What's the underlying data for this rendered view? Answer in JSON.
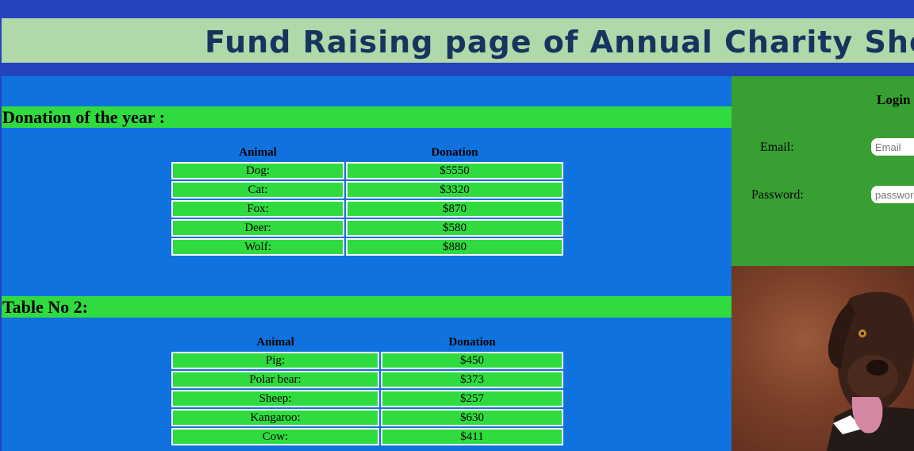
{
  "header": {
    "title": "Fund Raising page of Annual Charity Show"
  },
  "section1": {
    "title": "Donation of the year :",
    "headers": [
      "Animal",
      "Donation"
    ],
    "rows": [
      [
        "Dog:",
        "$5550"
      ],
      [
        "Cat:",
        "$3320"
      ],
      [
        "Fox:",
        "$870"
      ],
      [
        "Deer:",
        "$580"
      ],
      [
        "Wolf:",
        "$880"
      ]
    ]
  },
  "section2": {
    "title": "Table No 2:",
    "headers": [
      "Animal",
      "Donation"
    ],
    "rows": [
      [
        "Pig:",
        "$450"
      ],
      [
        "Polar bear:",
        "$373"
      ],
      [
        "Sheep:",
        "$257"
      ],
      [
        "Kangaroo:",
        "$630"
      ],
      [
        "Cow:",
        "$411"
      ]
    ]
  },
  "login": {
    "title": "Login",
    "email_label": "Email:",
    "email_placeholder": "Email",
    "password_label": "Password:",
    "password_placeholder": "password"
  },
  "colors": {
    "background": "#2443bd",
    "header_band": "#b0d8a9",
    "title_text": "#16355e",
    "main_panel": "#0f72de",
    "accent_green": "#2fdb3f",
    "login_panel": "#38a033"
  }
}
